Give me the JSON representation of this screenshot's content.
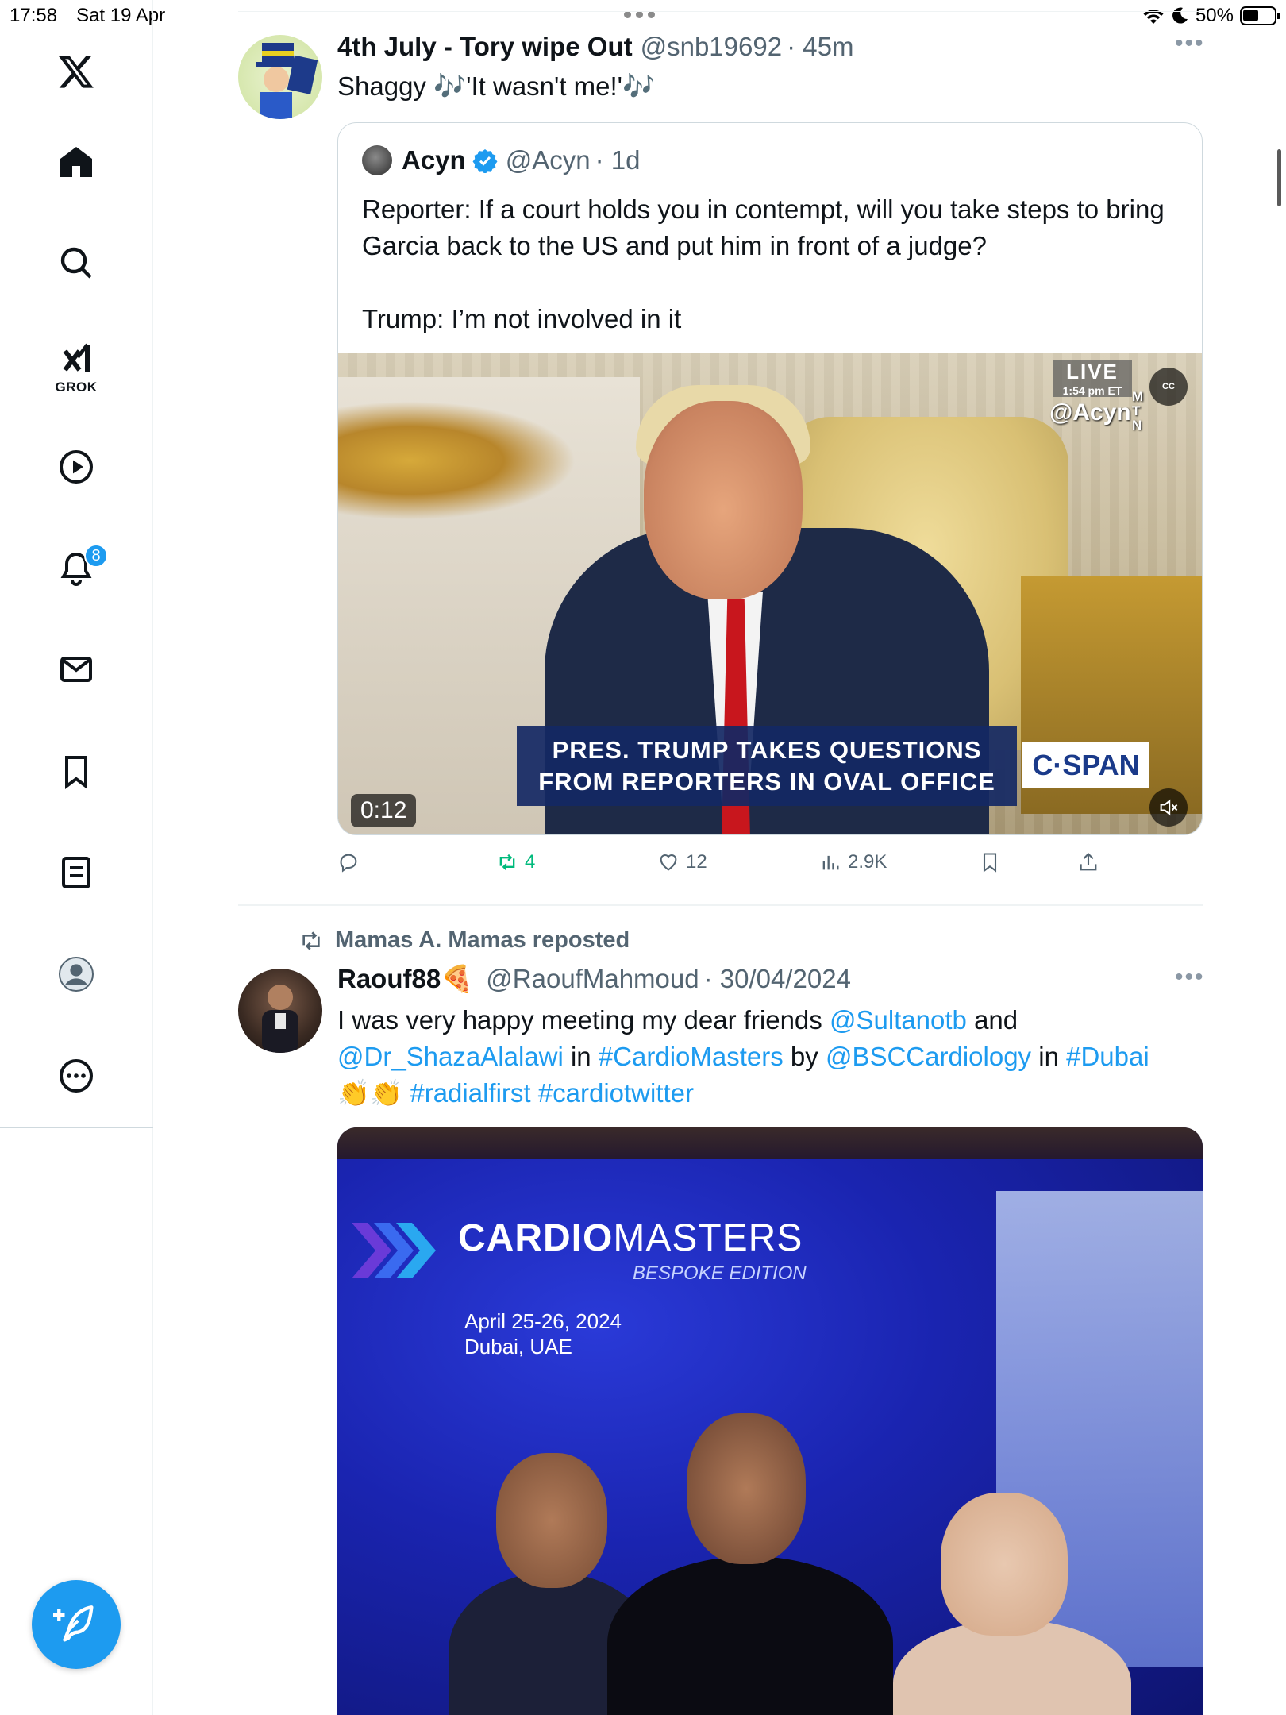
{
  "status_bar": {
    "time": "17:58",
    "date": "Sat 19 Apr",
    "battery": "50%"
  },
  "sidebar": {
    "items": [
      {
        "name": "x-logo"
      },
      {
        "name": "home"
      },
      {
        "name": "search"
      },
      {
        "name": "grok",
        "label": "GROK"
      },
      {
        "name": "videos"
      },
      {
        "name": "notifications",
        "badge": "8"
      },
      {
        "name": "messages"
      },
      {
        "name": "bookmarks"
      },
      {
        "name": "lists"
      },
      {
        "name": "profile"
      },
      {
        "name": "more"
      }
    ],
    "compose_icon": "feather-plus-icon"
  },
  "tweet1": {
    "name": "4th July - Tory wipe Out",
    "handle": "@snb19692",
    "time": "· 45m",
    "text": "Shaggy 🎶'It wasn't me!'🎶",
    "quote": {
      "name": "Acyn",
      "handle": "@Acyn",
      "time": "· 1d",
      "text_line1": "Reporter: If a court holds you in contempt, will you take steps to bring Garcia back to the US and put him in front of a judge?",
      "text_line2": "Trump: I’m not involved in it",
      "video": {
        "duration": "0:12",
        "banner_line1": "PRES. TRUMP TAKES QUESTIONS",
        "banner_line2": "FROM REPORTERS IN OVAL OFFICE",
        "network": "C·SPAN",
        "live": "LIVE",
        "live_time": "1:54 pm ET",
        "watermark": "@Acyn",
        "mtn": "M T N",
        "cc": "CC"
      }
    },
    "actions": {
      "replies": "",
      "reposts": "4",
      "likes": "12",
      "views": "2.9K"
    }
  },
  "tweet2": {
    "reposted_by": "Mamas A. Mamas reposted",
    "name": "Raouf88🍕",
    "handle": "@RaoufMahmoud",
    "time": "· 30/04/2024",
    "text": {
      "t1": "I was very happy meeting my dear friends ",
      "m1": "@Sultanotb",
      "t2": " and ",
      "m2": "@Dr_ShazaAlalawi",
      "t3": " in ",
      "h1": "#CardioMasters",
      "t4": " by ",
      "m3": "@BSCCardiology",
      "t5": " in ",
      "h2": "#Dubai",
      "emoji": "👏👏 ",
      "h3": "#radialfirst",
      "h4": "#cardiotwitter"
    },
    "photo": {
      "title_bold": "CARDIO",
      "title_light": "MASTERS",
      "subtitle": "BESPOKE EDITION",
      "date_line": "April 25-26, 2024",
      "place_line": "Dubai, UAE"
    }
  },
  "colors": {
    "accent": "#1d9bf0",
    "repost_green": "#00ba7c",
    "muted": "#536471"
  }
}
